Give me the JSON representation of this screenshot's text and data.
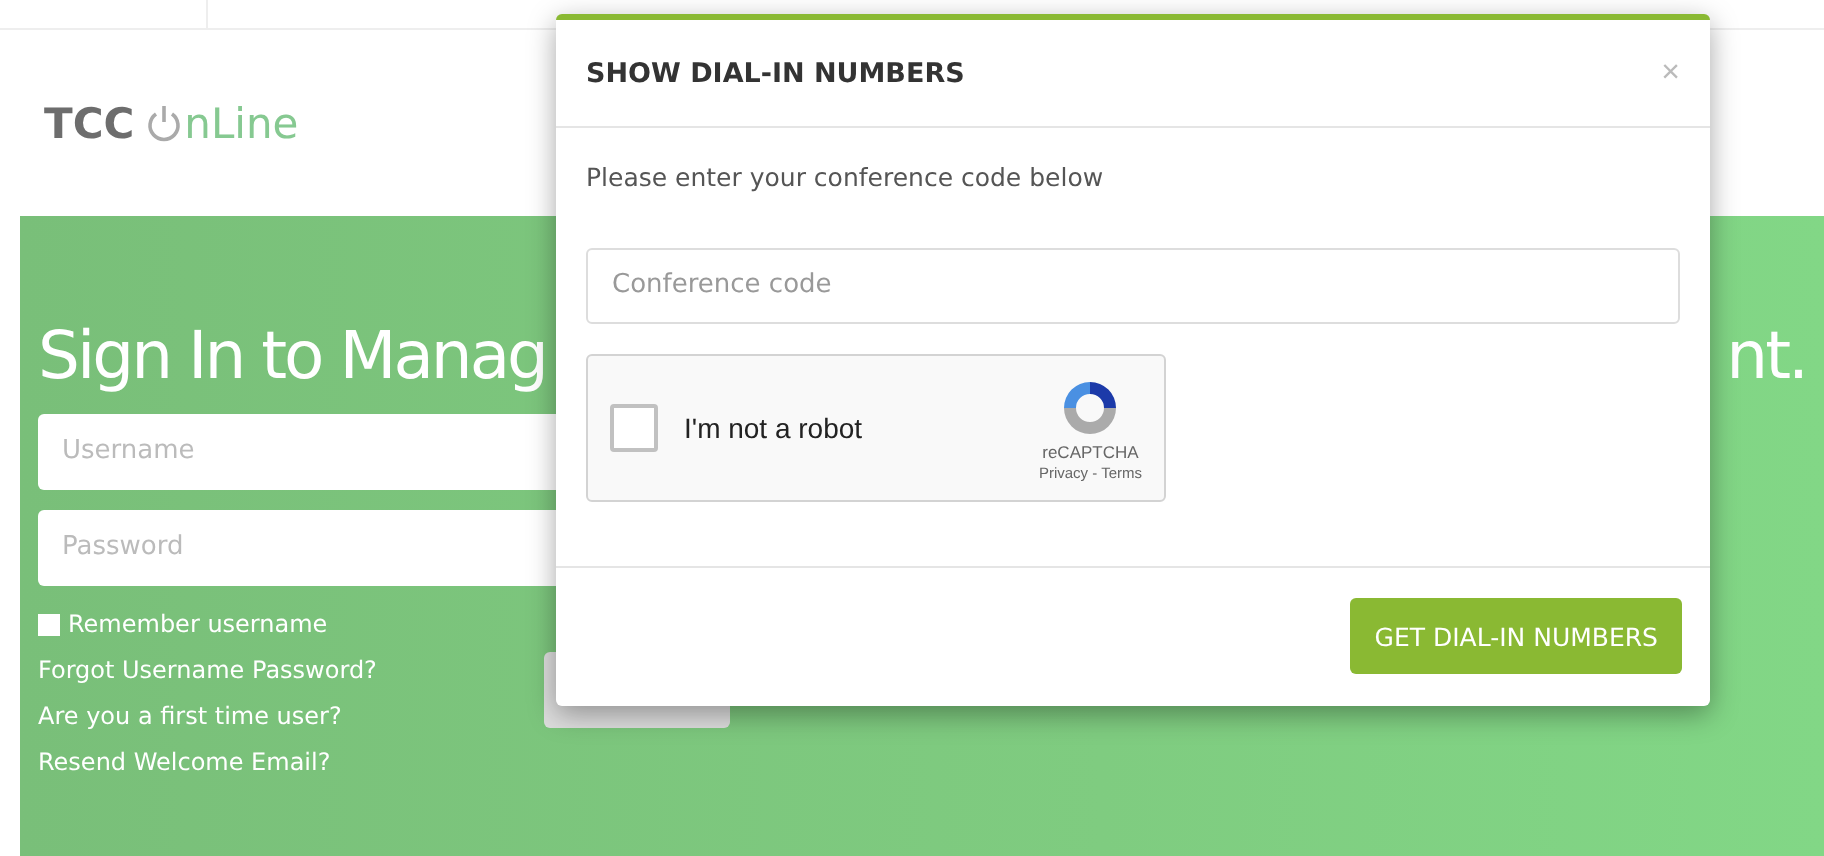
{
  "logo": {
    "brand": "TCC",
    "product": "nLine"
  },
  "hero": {
    "heading_left": "Sign In to Manag",
    "heading_right": "nt.",
    "username": {
      "placeholder": "Username"
    },
    "password": {
      "placeholder": "Password"
    },
    "remember": {
      "label": "Remember username",
      "checked": false
    },
    "links": [
      "Forgot Username Password?",
      "Are you a first time user?",
      "Resend Welcome Email?"
    ]
  },
  "modal": {
    "title": "SHOW DIAL-IN NUMBERS",
    "close": "×",
    "prompt": "Please enter your conference code below",
    "code_field": {
      "placeholder": "Conference code"
    },
    "captcha": {
      "label": "I'm not a robot",
      "checked": false,
      "brand": "reCAPTCHA",
      "links": "Privacy - Terms"
    },
    "button": "GET DIAL-IN NUMBERS"
  }
}
